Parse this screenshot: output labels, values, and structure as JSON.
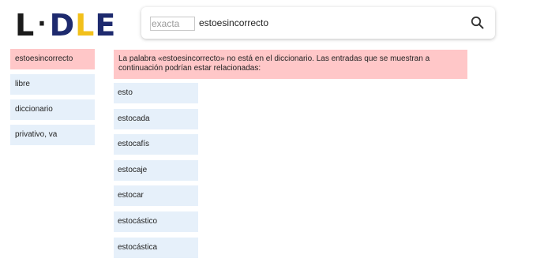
{
  "logo": {
    "l1": "L",
    "dot": "·",
    "d": "D",
    "l2": "L",
    "e": "E"
  },
  "search": {
    "exact_placeholder": "exacta",
    "query": "estoesincorrecto",
    "button_icon": "search-icon"
  },
  "sidebar": {
    "items": [
      {
        "label": "estoesincorrecto",
        "active": true
      },
      {
        "label": "libre"
      },
      {
        "label": "diccionario"
      },
      {
        "label": "privativo, va"
      }
    ]
  },
  "notice": {
    "text": "La palabra «estoesincorrecto» no está en el diccionario. Las entradas que se muestran a continuación podrían estar relacionadas:"
  },
  "results": [
    "esto",
    "estocada",
    "estocafís",
    "estocaje",
    "estocar",
    "estocástico",
    "estocástica"
  ],
  "colors": {
    "notice_bg": "#ffc7c8",
    "item_bg": "#e6f0fa",
    "logo_blue": "#1e2a6e",
    "logo_yellow": "#f2c01b"
  }
}
